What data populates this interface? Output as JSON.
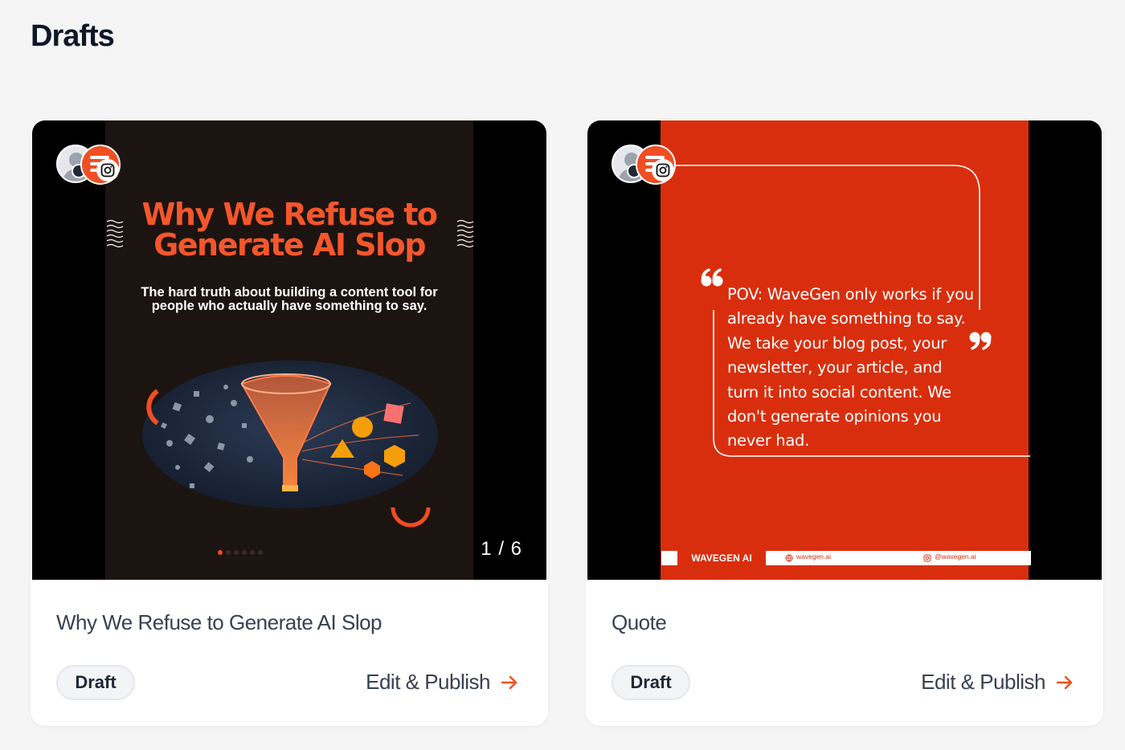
{
  "page": {
    "title": "Drafts"
  },
  "colors": {
    "accent": "#f04e23",
    "slide_bg_dark": "#1c1411",
    "slide_bg_red": "#d92e0d"
  },
  "drafts": [
    {
      "title": "Why We Refuse to Generate AI Slop",
      "status": "Draft",
      "action": "Edit & Publish",
      "platform_icon": "instagram-icon",
      "slide": {
        "headline_line1": "Why We Refuse to",
        "headline_line2": "Generate AI Slop",
        "subtitle_line1": "The hard truth about building a content tool for",
        "subtitle_line2": "people who actually have something to say.",
        "counter": "1 / 6"
      }
    },
    {
      "title": "Quote",
      "status": "Draft",
      "action": "Edit & Publish",
      "platform_icon": "instagram-icon",
      "slide": {
        "quote": "POV: WaveGen only works if you already have something to say. We take your blog post, your newsletter, your article, and turn it into social content. We don't generate opinions you never had.",
        "brand": "WAVEGEN AI",
        "website": "wavegen.ai",
        "handle": "@wavegen.ai"
      }
    }
  ]
}
